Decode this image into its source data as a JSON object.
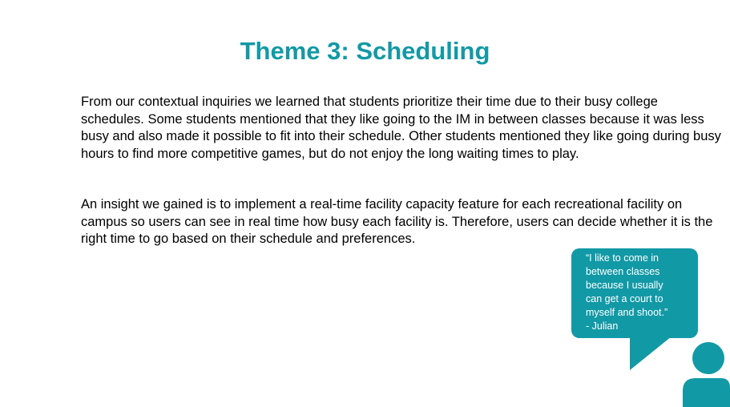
{
  "slide": {
    "title": "Theme 3: Scheduling",
    "paragraph1": "From our contextual inquiries we learned that students prioritize their time due to their busy college schedules. Some students mentioned that they like going to the IM in between classes because it was less busy and also made it possible to fit into their schedule. Other students mentioned they like going during busy hours to find more competitive games, but do not enjoy the long waiting times to play.",
    "paragraph2": "An insight we gained is to implement a real-time facility capacity feature for each recreational facility on campus so users can see in real time how busy each facility is. Therefore, users can decide whether it is the right time to go based on their schedule and preferences.",
    "quote": "“I like to come in\nbetween classes\nbecause I usually\ncan get a court to\nmyself and shoot.”\n- Julian"
  },
  "colors": {
    "accent": "#1299a6",
    "text": "#000000",
    "background": "#ffffff"
  },
  "icons": {
    "person": "person-icon",
    "bubble": "speech-bubble"
  }
}
